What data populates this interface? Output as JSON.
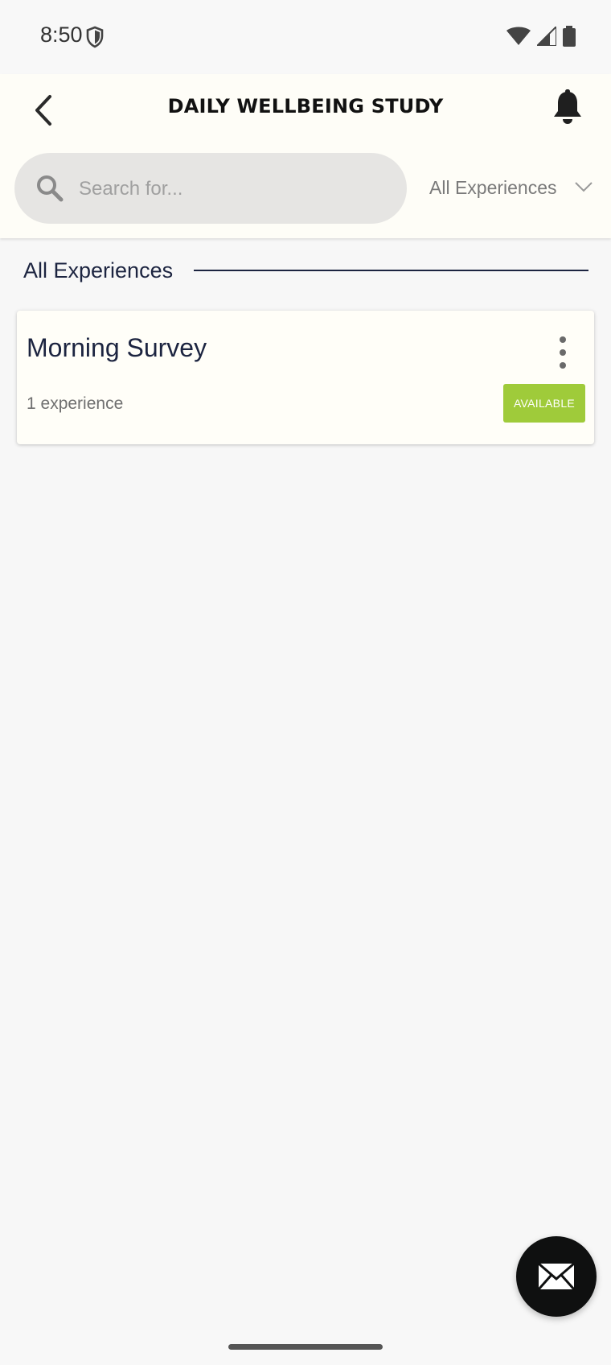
{
  "status_bar": {
    "time": "8:50"
  },
  "header": {
    "title": "DAILY WELLBEING STUDY"
  },
  "search": {
    "placeholder": "Search for...",
    "value": ""
  },
  "filter": {
    "selected": "All Experiences"
  },
  "section": {
    "title": "All Experiences"
  },
  "cards": [
    {
      "title": "Morning Survey",
      "subtitle": "1 experience",
      "badge": "AVAILABLE",
      "badge_color": "#9fcb3a"
    }
  ],
  "colors": {
    "header_bg": "#fefdf7",
    "text_primary": "#1c2440",
    "fab_bg": "#0f1010"
  },
  "icons": {
    "back": "chevron-left-icon",
    "notifications": "bell-icon",
    "search": "search-icon",
    "dropdown": "chevron-down-icon",
    "more": "more-vertical-icon",
    "fab": "mail-icon"
  }
}
